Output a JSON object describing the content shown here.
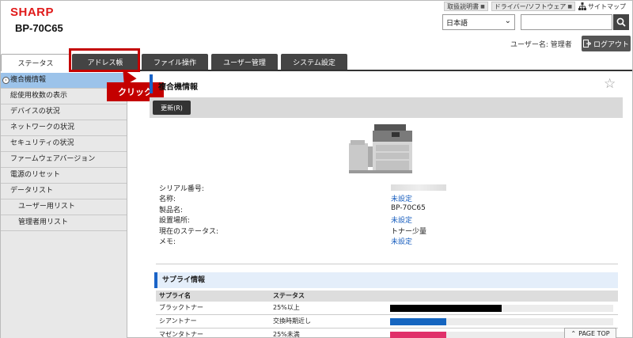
{
  "brand": {
    "logo": "SHARP",
    "model": "BP-70C65"
  },
  "toplinks": {
    "manual": "取扱説明書",
    "driver": "ドライバー/ソフトウェア",
    "sitemap": "サイトマップ"
  },
  "header": {
    "language": "日本語",
    "search_placeholder": "",
    "username": "ユーザー名: 管理者",
    "logout": "ログアウト"
  },
  "tabs": [
    {
      "label": "ステータス"
    },
    {
      "label": "アドレス帳"
    },
    {
      "label": "ファイル操作"
    },
    {
      "label": "ユーザー管理"
    },
    {
      "label": "システム設定"
    }
  ],
  "callout": {
    "label": "クリック"
  },
  "sidebar": {
    "items": [
      {
        "label": "複合機情報"
      },
      {
        "label": "総使用枚数の表示"
      },
      {
        "label": "デバイスの状況"
      },
      {
        "label": "ネットワークの状況"
      },
      {
        "label": "セキュリティの状況"
      },
      {
        "label": "ファームウェアバージョン"
      },
      {
        "label": "電源のリセット"
      },
      {
        "label": "データリスト"
      },
      {
        "label": "ユーザー用リスト"
      },
      {
        "label": "管理者用リスト"
      }
    ]
  },
  "main": {
    "title": "複合機情報",
    "refresh": "更新(R)",
    "info": [
      {
        "key": "シリアル番号:",
        "value": ""
      },
      {
        "key": "名称:",
        "value": "未設定"
      },
      {
        "key": "製品名:",
        "value": "BP-70C65"
      },
      {
        "key": "設置場所:",
        "value": "未設定"
      },
      {
        "key": "現在のステータス:",
        "value": "トナー少量"
      },
      {
        "key": "メモ:",
        "value": "未設定"
      }
    ],
    "supply": {
      "heading": "サプライ情報",
      "columns": [
        "サプライ名",
        "ステータス"
      ],
      "rows": [
        {
          "name": "ブラックトナー",
          "status": "25%以上",
          "level": 0.5,
          "color": "#000000"
        },
        {
          "name": "シアントナー",
          "status": "交換時期近し",
          "level": 0.25,
          "color": "#1565c0"
        },
        {
          "name": "マゼンタトナー",
          "status": "25%未満",
          "level": 0.25,
          "color": "#e0306a"
        }
      ]
    },
    "pagetop": "PAGE TOP"
  }
}
